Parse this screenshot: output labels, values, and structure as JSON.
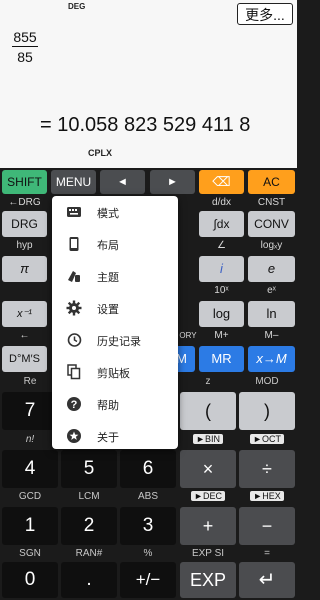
{
  "display": {
    "angle_mode": "DEG",
    "more_button": "更多...",
    "fraction_numerator": "855",
    "fraction_denominator": "85",
    "result": "= 10.058 823 529 411 8",
    "mode_indicator": "CPLX"
  },
  "keys": {
    "shift": "SHIFT",
    "menu": "MENU",
    "left": "◄",
    "right": "►",
    "backspace": "⌫",
    "ac": "AC",
    "drg_label": "←DRG",
    "drg": "DRG",
    "ddx_label": "d/dx",
    "integral": "∫dx",
    "cnst_label": "CNST",
    "conv": "CONV",
    "hyp_label": "hyp",
    "angle_label": "∠",
    "log_label": "logₓy",
    "pi": "π",
    "i": "i",
    "e": "e",
    "exp10_label": "10ˣ",
    "ex_label": "eˣ",
    "reciprocal": "x⁻¹",
    "log": "log",
    "ln": "ln",
    "arrow_label": "←",
    "ory_label": "ORY",
    "mplus_label": "M+",
    "mminus_label": "M–",
    "dms": "D°M′S",
    "m_key": "M",
    "mr": "MR",
    "to_m": "x→M",
    "re_label": "Re",
    "z_label": "z",
    "mod_label": "MOD",
    "seven": "7",
    "lparen": "(",
    "rparen": ")",
    "fact_label": "n!",
    "bin_label": "►BIN",
    "oct_label": "►OCT",
    "four": "4",
    "five": "5",
    "six": "6",
    "times": "×",
    "divide": "÷",
    "gcd_label": "GCD",
    "lcm_label": "LCM",
    "abs_label": "ABS",
    "dec_label": "►DEC",
    "hex_label": "►HEX",
    "one": "1",
    "two": "2",
    "three": "3",
    "plus": "+",
    "minus": "−",
    "sgn_label": "SGN",
    "ran_label": "RAN#",
    "percent_label": "%",
    "expsi_label": "EXP SI",
    "equals_label": "=",
    "zero": "0",
    "dot": ".",
    "negate": "+/−",
    "exp": "EXP",
    "enter": "↵"
  },
  "menu": {
    "items": [
      {
        "label": "模式",
        "icon": "keyboard-icon"
      },
      {
        "label": "布局",
        "icon": "phone-icon"
      },
      {
        "label": "主题",
        "icon": "palette-icon"
      },
      {
        "label": "设置",
        "icon": "gear-icon"
      },
      {
        "label": "历史记录",
        "icon": "history-icon"
      },
      {
        "label": "剪贴板",
        "icon": "clipboard-icon"
      },
      {
        "label": "帮助",
        "icon": "help-icon"
      },
      {
        "label": "关于",
        "icon": "star-badge-icon"
      }
    ]
  },
  "colors": {
    "shift": "#3fb878",
    "ac": "#ff9f1c",
    "memory": "#2c7be5"
  }
}
